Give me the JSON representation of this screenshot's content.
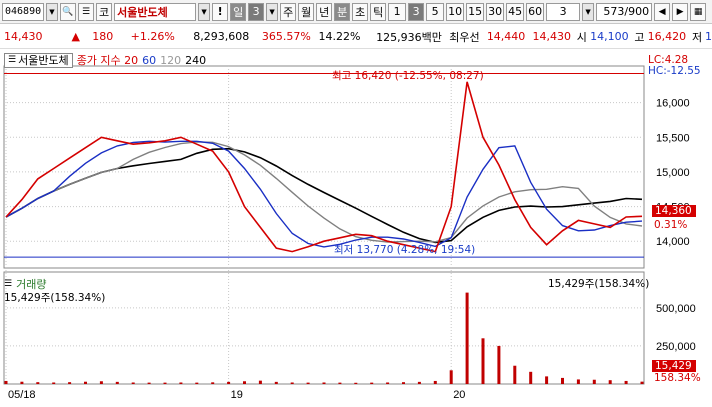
{
  "toolbar": {
    "code": "046890",
    "market": "코",
    "name": "서울반도체",
    "alert": "!",
    "period_active": "일",
    "period_value": "3",
    "periods": [
      "주",
      "월",
      "년"
    ],
    "period_min": "분",
    "period_sec": "초",
    "period_tick": "틱",
    "nums": [
      "1",
      "3",
      "5",
      "10",
      "15",
      "30",
      "45",
      "60"
    ],
    "interval_input": "3",
    "counter": "573/900"
  },
  "quote": {
    "price": "14,430",
    "change": "180",
    "change_pct": "+1.26%",
    "volume": "8,293,608",
    "vol_ratio": "365.57%",
    "turnover": "14.22%",
    "amount": "125,936백만",
    "best_label": "최우선",
    "ask": "14,440",
    "bid": "14,430",
    "open_label": "시",
    "open": "14,100",
    "high_label": "고",
    "high": "16,420",
    "low_label": "저",
    "low": "1"
  },
  "legend": {
    "title": "서울반도체",
    "ma_label": "종가 지수 20",
    "ma1": "60",
    "ma2": "120",
    "ma3": "240"
  },
  "annotations": {
    "high": "최고 16,420 (-12.55%, 08:27)",
    "low": "최저 13,770 (4.28%, 19:54)",
    "lc": "LC:4.28",
    "hc": "HC:-12.55",
    "price_tag": "14,360",
    "pct_tag": "0.31%",
    "vol_label": "15,429주(158.34%)",
    "vol_tag": "15,429",
    "vol_pct_tag": "158.34%",
    "vol_right_tag": "15,429주(158.34%)"
  },
  "volume_panel": {
    "title": "거래량"
  },
  "colors": {
    "price": "#d40000",
    "ma20": "#1a2fc4",
    "ma60": "#808080",
    "ma240": "#000000",
    "volume": "#c00000",
    "grid": "#c8c8c8"
  },
  "chart_data": [
    {
      "type": "line",
      "series": [
        {
          "name": "종가",
          "values": [
            14350,
            14600,
            14900,
            15050,
            15200,
            15350,
            15500,
            15450,
            15400,
            15420,
            15450,
            15500,
            15400,
            15300,
            15000,
            14500,
            14200,
            13900,
            13850,
            13920,
            14000,
            14050,
            14100,
            14080,
            14000,
            13950,
            13900,
            13850,
            14500,
            16300,
            15500,
            15100,
            14600,
            14200,
            13950,
            14150,
            14300,
            14250,
            14200,
            14350,
            14360
          ]
        }
      ],
      "x": [
        "05/18",
        "",
        "",
        "",
        "",
        "",
        "",
        "",
        "",
        "",
        "",
        "",
        "",
        "",
        "19",
        "",
        "",
        "",
        "",
        "",
        "",
        "",
        "",
        "",
        "",
        "",
        "",
        "",
        "20",
        "",
        "",
        "",
        "",
        "",
        "",
        "",
        "",
        "",
        "",
        "",
        ""
      ],
      "ylim": [
        13700,
        16500
      ],
      "yticks": [
        14000,
        14500,
        15000,
        15500,
        16000
      ],
      "ylabel": "",
      "xlabel": ""
    },
    {
      "type": "bar",
      "series": [
        {
          "name": "거래량",
          "values": [
            20000,
            15000,
            12000,
            10000,
            12000,
            15000,
            18000,
            14000,
            10000,
            9000,
            9000,
            10000,
            9000,
            11000,
            14000,
            18000,
            22000,
            14000,
            10000,
            9000,
            10000,
            9000,
            8000,
            9000,
            10000,
            12000,
            14000,
            20000,
            90000,
            600000,
            300000,
            250000,
            120000,
            80000,
            50000,
            40000,
            30000,
            28000,
            25000,
            20000,
            15429
          ]
        }
      ],
      "ylim": [
        0,
        650000
      ],
      "yticks": [
        250000,
        500000
      ]
    }
  ]
}
